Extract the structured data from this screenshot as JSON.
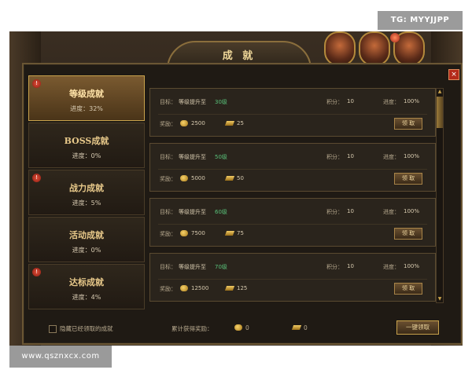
{
  "overlay": {
    "tg_label": "TG: MYYJJPP",
    "watermark": "www.qsznxcx.com"
  },
  "window": {
    "title": "成 就",
    "close_label": "×"
  },
  "categories": [
    {
      "name": "等级成就",
      "progress": "进度：32%",
      "badge": "!",
      "active": true
    },
    {
      "name": "BOSS成就",
      "progress": "进度：0%",
      "badge": ""
    },
    {
      "name": "战力成就",
      "progress": "进度：5%",
      "badge": "!"
    },
    {
      "name": "活动成就",
      "progress": "进度：0%",
      "badge": ""
    },
    {
      "name": "达标成就",
      "progress": "进度：4%",
      "badge": "!"
    }
  ],
  "list_labels": {
    "goal": "目标：",
    "goal_text": "等级提升至",
    "points": "积分：",
    "progress": "进度：",
    "reward": "奖励：",
    "claim": "领 取"
  },
  "achievements": [
    {
      "level": "30级",
      "points": "10",
      "progress": "100%",
      "gold": "2500",
      "ingot": "25"
    },
    {
      "level": "50级",
      "points": "10",
      "progress": "100%",
      "gold": "5000",
      "ingot": "50"
    },
    {
      "level": "60级",
      "points": "10",
      "progress": "100%",
      "gold": "7500",
      "ingot": "75"
    },
    {
      "level": "70级",
      "points": "10",
      "progress": "100%",
      "gold": "12500",
      "ingot": "125"
    }
  ],
  "footer": {
    "hide_claimed": "隐藏已经领取的成就",
    "total_label": "累计获得奖励：",
    "total_gold": "0",
    "total_ingot": "0",
    "claim_all": "一键领取"
  },
  "colors": {
    "accent": "#c8a24c",
    "level_text": "#59c27a",
    "panel_bg": "#1f1a14"
  },
  "icons": [
    "gold-coin-icon",
    "ingot-icon",
    "close-icon",
    "checkbox-icon"
  ]
}
